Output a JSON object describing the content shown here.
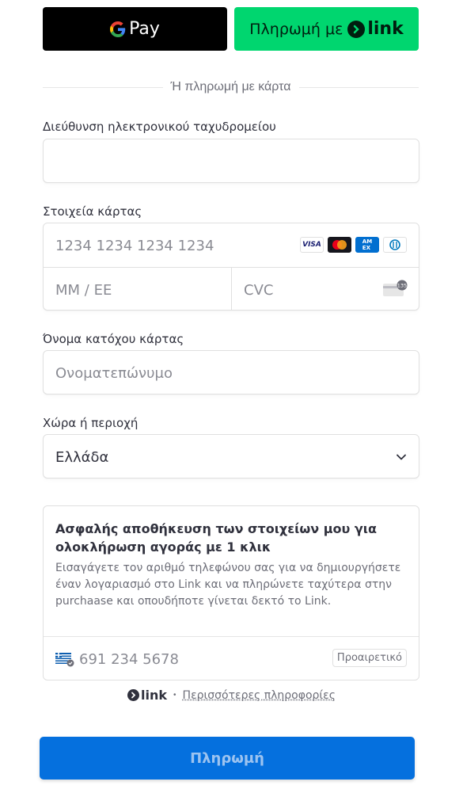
{
  "wallets": {
    "gpay_label": "Pay",
    "link_label": "Πληρωμή με",
    "link_word": "link"
  },
  "divider_text": "Ή πληρωμή με κάρτα",
  "email": {
    "label": "Διεύθυνση ηλεκτρονικού ταχυδρομείου",
    "value": ""
  },
  "card": {
    "label": "Στοιχεία κάρτας",
    "number_placeholder": "1234 1234 1234 1234",
    "expiry_placeholder": "ΜΜ / ΕΕ",
    "cvc_placeholder": "CVC",
    "brands": [
      "VISA",
      "mastercard",
      "amex",
      "diners"
    ]
  },
  "cardholder": {
    "label": "Όνομα κατόχου κάρτας",
    "placeholder": "Ονοματεπώνυμο"
  },
  "country": {
    "label": "Χώρα ή περιοχή",
    "value": "Ελλάδα"
  },
  "link_save": {
    "title": "Ασφαλής αποθήκευση των στοιχείων μου για ολοκλήρωση αγοράς με 1 κλικ",
    "description": "Εισαγάγετε τον αριθμό τηλεφώνου σας για να δημιουργήσετε έναν λογαριασμό στο Link και να πληρώνετε ταχύτερα στην purchaase και οπουδήποτε γίνεται δεκτό το Link.",
    "phone_placeholder": "691 234 5678",
    "optional_label": "Προαιρετικό"
  },
  "footer": {
    "link_word": "link",
    "separator": "•",
    "more_info": "Περισσότερες πληροφορίες"
  },
  "pay_button_label": "Πληρωμή",
  "colors": {
    "link_green": "#00d66f",
    "pay_blue": "#0570de"
  }
}
